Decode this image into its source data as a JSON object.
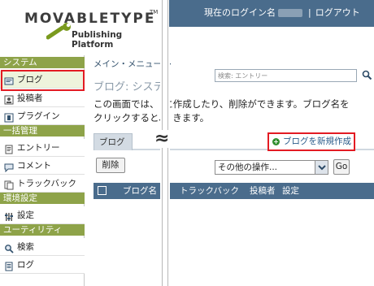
{
  "logo": {
    "wordmark": "MOVABLETYPE",
    "tm": "TM",
    "tagline": "Publishing Platform"
  },
  "sidebar": {
    "sections": [
      {
        "label": "システム",
        "items": [
          {
            "label": "ブログ",
            "icon": "blog-icon"
          },
          {
            "label": "投稿者",
            "icon": "author-icon"
          },
          {
            "label": "プラグイン",
            "icon": "plugin-icon"
          }
        ]
      },
      {
        "label": "一括管理",
        "items": [
          {
            "label": "エントリー",
            "icon": "entry-icon"
          },
          {
            "label": "コメント",
            "icon": "comment-icon"
          },
          {
            "label": "トラックバック",
            "icon": "trackback-icon"
          }
        ]
      },
      {
        "label": "環境設定",
        "items": [
          {
            "label": "設定",
            "icon": "settings-icon"
          }
        ]
      },
      {
        "label": "ユーティリティ",
        "items": [
          {
            "label": "検索",
            "icon": "search-icon"
          },
          {
            "label": "ログ",
            "icon": "log-icon"
          }
        ]
      }
    ]
  },
  "header": {
    "logged_in_label": "現在のログイン名",
    "separator": "|",
    "logout": "ログアウト"
  },
  "search": {
    "placeholder": "検索: エントリー"
  },
  "main": {
    "breadcrumb": "メイン・メニュー >",
    "title": "ブログ: システ",
    "description_line1": "この画面では、　に作成したり、削除ができます。ブログ名を",
    "description_line2": "クリックすると、　きます。",
    "tab_blog": "ブログ",
    "break_symbol": "≈",
    "new_blog": "ブログを新規作成",
    "delete_button": "削除",
    "other_actions": "その他の操作...",
    "go_button": "Go",
    "columns": {
      "name": "ブログ名",
      "trackback": "トラックバック",
      "author": "投稿者",
      "settings": "設定"
    }
  },
  "colors": {
    "sidebar_section": "#8ea349",
    "header_blue": "#4a6c8c",
    "highlight_red": "#e31b23",
    "link_blue": "#2a5b8a"
  }
}
